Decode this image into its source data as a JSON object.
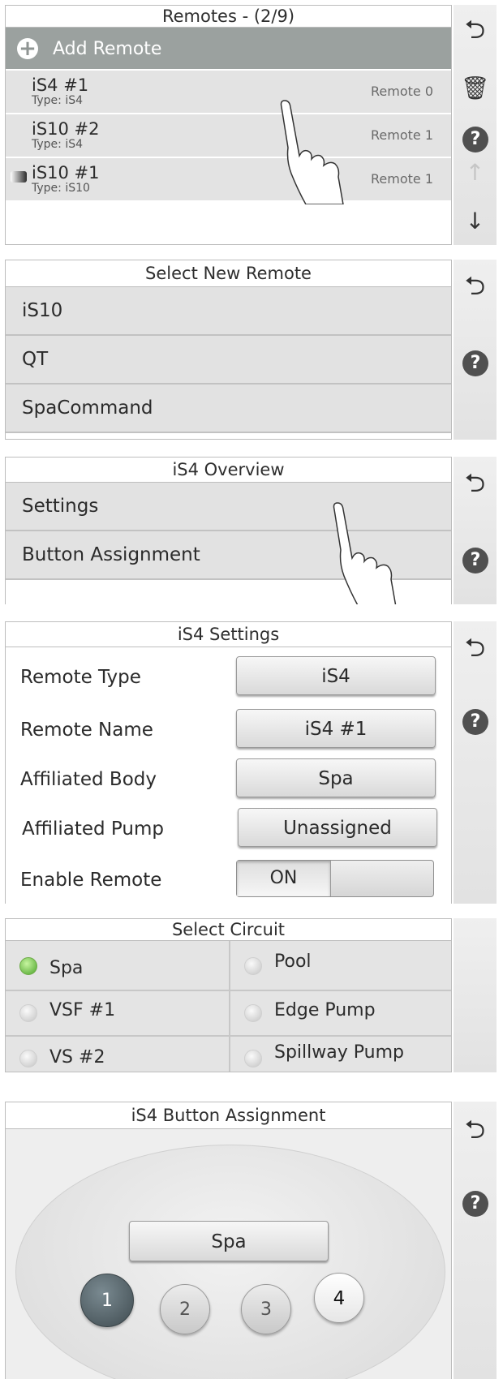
{
  "remotes": {
    "title": "Remotes - (2/9)",
    "add_label": "Add Remote",
    "items": [
      {
        "name": "iS4 #1",
        "type": "Type: iS4",
        "slot": "Remote 0"
      },
      {
        "name": "iS10 #2",
        "type": "Type: iS4",
        "slot": "Remote 1"
      },
      {
        "name": "iS10 #1",
        "type": "Type: iS10",
        "slot": "Remote 1"
      }
    ]
  },
  "select_remote": {
    "title": "Select New Remote",
    "options": [
      "iS10",
      "QT",
      "SpaCommand"
    ]
  },
  "overview": {
    "title": "iS4 Overview",
    "items": [
      "Settings",
      "Button Assignment"
    ]
  },
  "settings": {
    "title": "iS4 Settings",
    "fields": [
      {
        "label": "Remote Type",
        "value": "iS4"
      },
      {
        "label": "Remote Name",
        "value": "iS4 #1"
      },
      {
        "label": "Affiliated Body",
        "value": "Spa"
      },
      {
        "label": "Affiliated Pump",
        "value": "Unassigned"
      }
    ],
    "enable_label": "Enable Remote",
    "enable_value": "ON"
  },
  "select_circuit": {
    "title": "Select Circuit",
    "options": [
      "Spa",
      "Pool",
      "VSF #1",
      "Edge Pump",
      "VS #2",
      "Spillway Pump"
    ],
    "selected": "Spa"
  },
  "assignment": {
    "title": "iS4 Button Assignment",
    "display": "Spa",
    "keys": [
      "1",
      "2",
      "3",
      "4"
    ]
  },
  "icons": {
    "back": "back-arrow-icon",
    "help": "help-icon",
    "trash": "trash-icon",
    "up": "up-arrow-icon",
    "down": "down-arrow-icon",
    "add": "plus-circle-icon"
  },
  "glyphs": {
    "back": "⮌",
    "help": "?",
    "trash": "🗑",
    "up": "↑",
    "down": "↓",
    "add": "+"
  },
  "colors": {
    "header_bar": "#9aa09e",
    "selected_radio": "#4ca42a",
    "active_key": "#4e5c62"
  }
}
